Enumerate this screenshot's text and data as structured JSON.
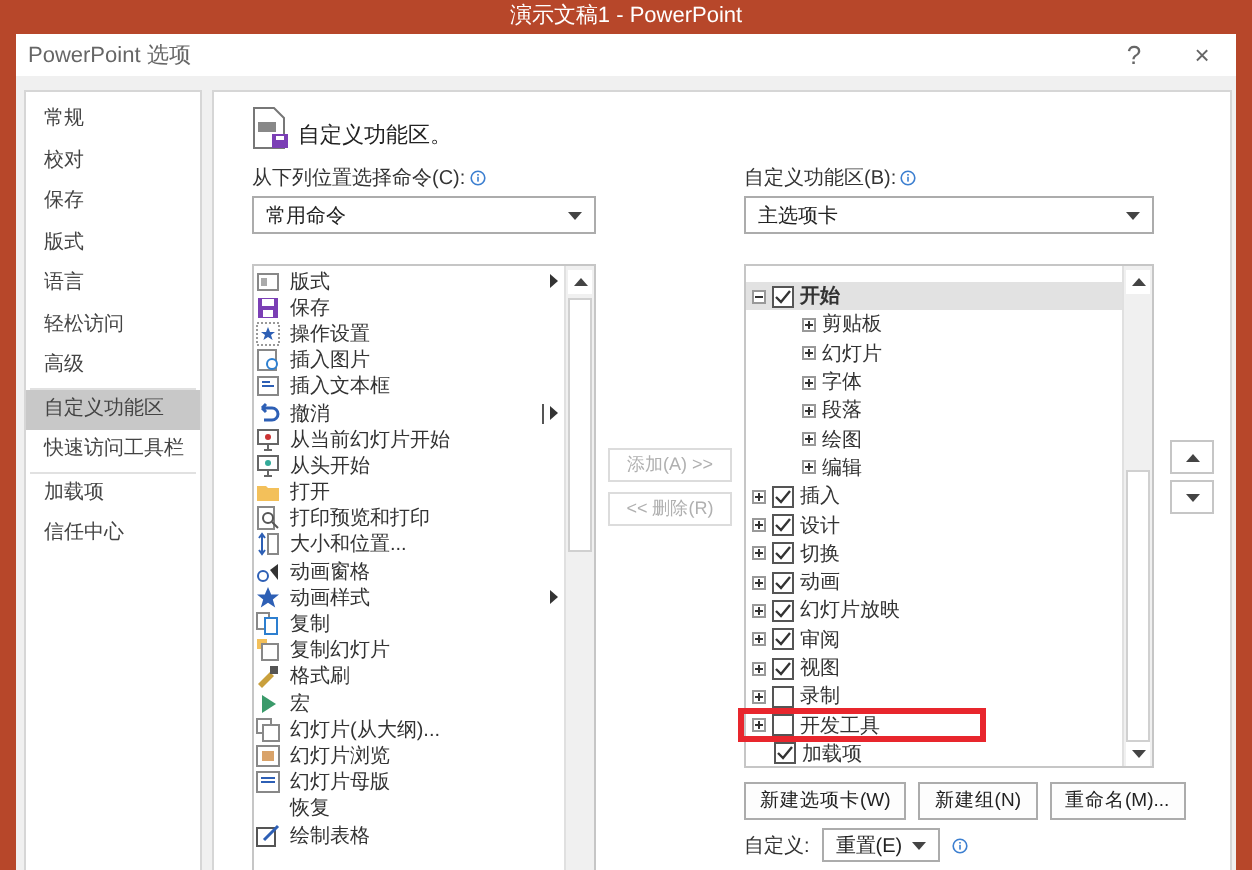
{
  "app_title": "演示文稿1  -  PowerPoint",
  "dialog": {
    "title": "PowerPoint 选项",
    "help": "?",
    "close": "×"
  },
  "nav": {
    "groups": [
      [
        {
          "label": "常规",
          "selected": false
        },
        {
          "label": "校对",
          "selected": false
        },
        {
          "label": "保存",
          "selected": false
        },
        {
          "label": "版式",
          "selected": false
        },
        {
          "label": "语言",
          "selected": false
        },
        {
          "label": "轻松访问",
          "selected": false
        },
        {
          "label": "高级",
          "selected": false
        }
      ],
      [
        {
          "label": "自定义功能区",
          "selected": true
        },
        {
          "label": "快速访问工具栏",
          "selected": false
        }
      ],
      [
        {
          "label": "加载项",
          "selected": false
        },
        {
          "label": "信任中心",
          "selected": false
        }
      ]
    ]
  },
  "heading": "自定义功能区。",
  "commands": {
    "label": "从下列位置选择命令(C):",
    "dropdown": "常用命令",
    "items": [
      {
        "label": "版式",
        "kind": "submenu"
      },
      {
        "label": "保存",
        "kind": "plain"
      },
      {
        "label": "操作设置",
        "kind": "plain"
      },
      {
        "label": "插入图片",
        "kind": "plain"
      },
      {
        "label": "插入文本框",
        "kind": "plain"
      },
      {
        "label": "撤消",
        "kind": "split"
      },
      {
        "label": "从当前幻灯片开始",
        "kind": "plain"
      },
      {
        "label": "从头开始",
        "kind": "plain"
      },
      {
        "label": "打开",
        "kind": "plain"
      },
      {
        "label": "打印预览和打印",
        "kind": "plain"
      },
      {
        "label": "大小和位置...",
        "kind": "plain"
      },
      {
        "label": "动画窗格",
        "kind": "plain"
      },
      {
        "label": "动画样式",
        "kind": "submenu"
      },
      {
        "label": "复制",
        "kind": "plain"
      },
      {
        "label": "复制幻灯片",
        "kind": "plain"
      },
      {
        "label": "格式刷",
        "kind": "plain"
      },
      {
        "label": "宏",
        "kind": "plain"
      },
      {
        "label": "幻灯片(从大纲)...",
        "kind": "plain"
      },
      {
        "label": "幻灯片浏览",
        "kind": "plain"
      },
      {
        "label": "幻灯片母版",
        "kind": "plain"
      },
      {
        "label": "恢复",
        "kind": "plain"
      },
      {
        "label": "绘制表格",
        "kind": "plain"
      }
    ]
  },
  "add_button": {
    "label": "添加(A) >>",
    "disabled": true
  },
  "remove_button": {
    "label": "<< 删除(R)",
    "disabled": true
  },
  "ribbon": {
    "label": "自定义功能区(B):",
    "dropdown": "主选项卡",
    "tabs": [
      {
        "label": "开始",
        "checked": true,
        "expanded": true,
        "selected": true,
        "highlighted": false,
        "children": [
          {
            "label": "剪贴板"
          },
          {
            "label": "幻灯片"
          },
          {
            "label": "字体"
          },
          {
            "label": "段落"
          },
          {
            "label": "绘图"
          },
          {
            "label": "编辑"
          }
        ]
      },
      {
        "label": "插入",
        "checked": true,
        "expanded": false,
        "selected": false,
        "highlighted": false
      },
      {
        "label": "设计",
        "checked": true,
        "expanded": false,
        "selected": false,
        "highlighted": false
      },
      {
        "label": "切换",
        "checked": true,
        "expanded": false,
        "selected": false,
        "highlighted": false
      },
      {
        "label": "动画",
        "checked": true,
        "expanded": false,
        "selected": false,
        "highlighted": false
      },
      {
        "label": "幻灯片放映",
        "checked": true,
        "expanded": false,
        "selected": false,
        "highlighted": false
      },
      {
        "label": "审阅",
        "checked": true,
        "expanded": false,
        "selected": false,
        "highlighted": false
      },
      {
        "label": "视图",
        "checked": true,
        "expanded": false,
        "selected": false,
        "highlighted": false
      },
      {
        "label": "录制",
        "checked": false,
        "expanded": false,
        "selected": false,
        "highlighted": false
      },
      {
        "label": "开发工具",
        "checked": false,
        "expanded": false,
        "selected": false,
        "highlighted": true
      },
      {
        "label": "加载项",
        "checked": true,
        "selected": false,
        "highlighted": false
      }
    ]
  },
  "buttons": [
    "新建选项卡(W)",
    "新建组(N)",
    "重命名(M)..."
  ],
  "customize": {
    "label": "自定义:",
    "reset": "重置(E)"
  }
}
